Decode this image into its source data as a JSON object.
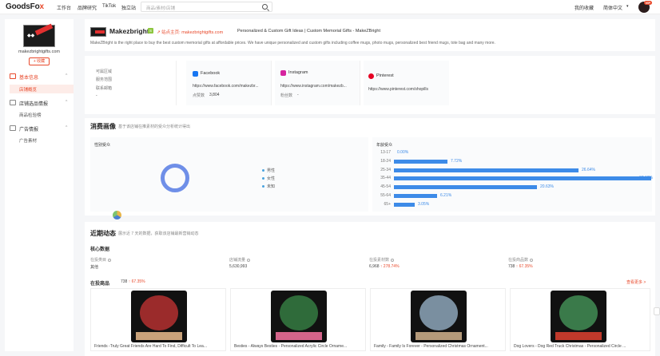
{
  "topbar": {
    "logo_main": "GoodsFo",
    "logo_accent": "x",
    "nav": [
      "工作台",
      "品牌研究",
      "TikTok",
      "独立站"
    ],
    "search_placeholder": "商品/素材/店铺",
    "favorites": "我的收藏",
    "language": "简体中文",
    "lang_chevron": "▾",
    "avatar_badge": "VIP"
  },
  "sidebar": {
    "shop_domain": "makezbrightgifts.com",
    "follow_label": "+ 收藏",
    "menu": [
      {
        "label": "基本信息",
        "sub": [
          "店铺概览"
        ]
      },
      {
        "label": "店铺选品情报",
        "sub": [
          "商品检验榜"
        ]
      },
      {
        "label": "广告情报",
        "sub": [
          "广告素材"
        ]
      }
    ],
    "chevron": "^"
  },
  "header": {
    "store_name": "Makezbright",
    "verified": "S",
    "direct_link": "↗ 站点主页: makezbrightgifts.com",
    "site_title": "Personalized & Custom Gift Ideas | Custom Memorial Gifts - MakeZBright",
    "description": "MakeZBright is the right place to buy the best custom memorial gifts at affordable prices. We have unique personalized and custom gifts including coffee mugs, photo mugs, personalized best friend mugs, tote bag and many more."
  },
  "info": {
    "labels": [
      "可属区域",
      "服务范围",
      "联系邮箱"
    ],
    "email_value": "-",
    "socials": [
      {
        "name": "Facebook",
        "url": "https://www.facebook.com/makezbr...",
        "stat_label": "点赞数",
        "stat_value": "3,804",
        "color": "#1877f2"
      },
      {
        "name": "Instagram",
        "url": "https://www.instagram.com/makezb...",
        "stat_label": "粉丝数",
        "stat_value": "-",
        "color": "#d6249f"
      },
      {
        "name": "Pinterest",
        "url": "https://www.pinterest.com/shopills",
        "color": "#e60023"
      }
    ]
  },
  "consumer": {
    "title": "消费画像",
    "subtitle": "基于该店铺在推素材的受众分析统计得出",
    "gender_title": "性别受众",
    "gender_legend": [
      "男性",
      "女性",
      "未知"
    ],
    "age_title": "年龄受众",
    "colors": {
      "donut": "#6f8fe8",
      "bar": "#3d8be8"
    }
  },
  "chart_data": {
    "type": "bar",
    "categories": [
      "13-17",
      "18-24",
      "25-34",
      "35-44",
      "45-54",
      "55-64",
      "65+"
    ],
    "values": [
      0.0,
      7.72,
      26.64,
      37.18,
      20.63,
      6.21,
      3.05
    ],
    "value_labels": [
      "0.00%",
      "7.72%",
      "26.64%",
      "37.18%",
      "20.63%",
      "6.21%",
      "3.05%"
    ],
    "title": "年龄受众",
    "xlim": [
      0,
      37.18
    ]
  },
  "recent": {
    "title": "近期动态",
    "subtitle": "展示近 7 天的数据，获取该店铺最新营销动态",
    "core_title": "核心数据",
    "metrics": [
      {
        "label": "在投类目",
        "value": "其他"
      },
      {
        "label": "店铺流量",
        "value": "5,630,993"
      },
      {
        "label": "在投素材数",
        "value": "6,968",
        "delta": "↑ 278.74%"
      },
      {
        "label": "在投商品数",
        "value": "738",
        "delta": "↑ 67.35%"
      }
    ],
    "products_label": "在投商品",
    "products_count": "738",
    "products_delta": "↑ 67.35%",
    "view_more": "查看更多 >",
    "products": [
      {
        "name": "Friends -Truly Great Friends Are Hard To Find, Difficult To Lea...",
        "color": "#9b2b2b"
      },
      {
        "name": "Besties - Always Besties - Personalized Acrylic Circle Orname...",
        "color": "#2f6b3a"
      },
      {
        "name": "Family - Family Is Forever - Personalized Christmas Ornament...",
        "color": "#7a8fa0"
      },
      {
        "name": "Dog Lovers - Dog Red Truck Christmas - Personalized Circle ...",
        "color": "#3a7a4a"
      }
    ]
  }
}
